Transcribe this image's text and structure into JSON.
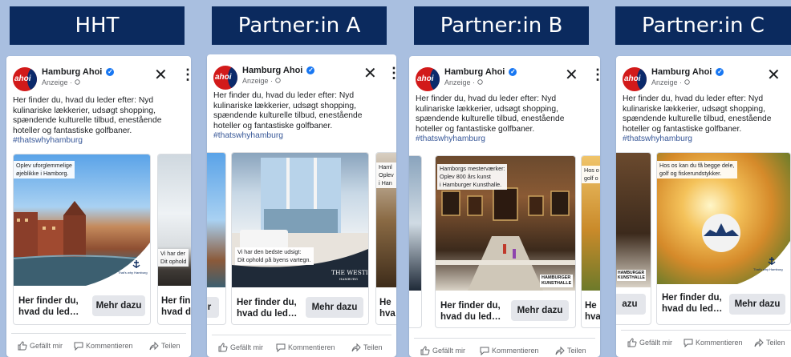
{
  "labels": [
    "HHT",
    "Partner:in A",
    "Partner:in B",
    "Partner:in C"
  ],
  "post": {
    "brand": "Hamburg Ahoi",
    "logo_text": "ahoi",
    "verified_mark": "✓",
    "sponsored": "Anzeige · ",
    "text_lines": [
      "Her finder du, hvad du leder efter: Nyd",
      "kulinariske lækkerier, udsøgt shopping,",
      "spændende kulturelle tilbud, enestående",
      "hoteller og fantastiske golfbaner."
    ],
    "hashtag": "#thatswhyhamburg",
    "close": "✕",
    "more": "⋮",
    "headline_1": "Her finder du,",
    "headline_2": "hvad du led…",
    "cta": "Mehr dazu",
    "like": "Gefällt mir",
    "comment": "Kommentieren",
    "share": "Teilen"
  },
  "cards": {
    "hht": {
      "overlay": [
        "Oplev uforglemmelige",
        "øjeblikke i Hamborg."
      ],
      "next_overlay": [
        "Vi har der",
        "Dit ophold"
      ],
      "next_headline": [
        "Her fin",
        "hvad d"
      ],
      "logo_mark": "That's why Hamburg"
    },
    "a": {
      "overlay": [
        "Vi har den bedste udsigt:",
        "Dit ophold på byens vartegn."
      ],
      "brand_mark": "THE WESTIN",
      "brand_sub": "HAMBURG",
      "prev_cta": "r",
      "next_overlay": [
        "Haml",
        "Oplev",
        "i Han"
      ],
      "next_headline": [
        "He",
        "hva"
      ]
    },
    "b": {
      "overlay": [
        "Hamborgs mesterværker:",
        "Oplev 800 års kunst",
        "i Hamburger Kunsthalle."
      ],
      "brand_mark": "HAMBURGER",
      "brand_sub": "KUNSTHALLE",
      "next_overlay": [
        "Hos o",
        "golf o"
      ],
      "next_headline": [
        "He",
        "hva"
      ]
    },
    "c": {
      "overlay": [
        "Hos os kan du få begge dele,",
        "golf og fiskerundstykker."
      ],
      "prev_cta": "azu",
      "prev_mark": [
        "HAMBURGER",
        "KUNSTHALLE"
      ],
      "logo_mark": "That's why Hamburg"
    }
  }
}
